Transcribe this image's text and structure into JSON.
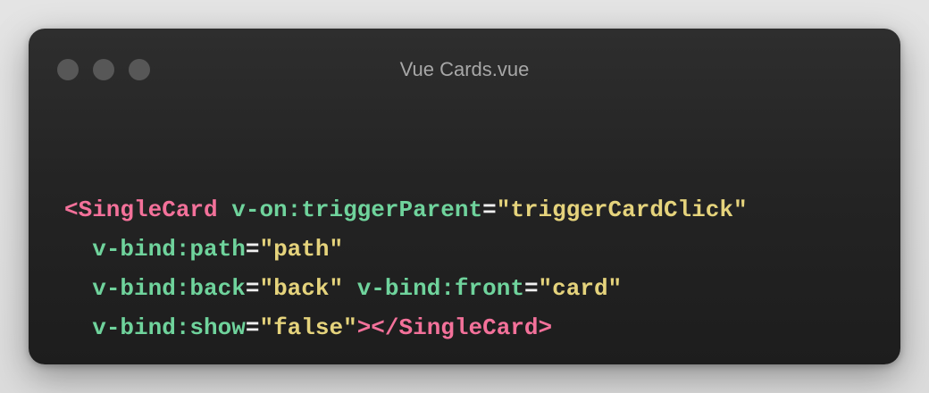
{
  "window": {
    "title": "Vue Cards.vue",
    "controls": [
      "close-dot",
      "minimize-dot",
      "maximize-dot"
    ]
  },
  "code": {
    "lines": [
      [
        {
          "t": "tag",
          "v": "<SingleCard"
        },
        {
          "t": "sp",
          "v": " "
        },
        {
          "t": "attr",
          "v": "v-on:triggerParent"
        },
        {
          "t": "eq",
          "v": "="
        },
        {
          "t": "str",
          "v": "\"triggerCardClick\""
        }
      ],
      [
        {
          "t": "sp",
          "v": "  "
        },
        {
          "t": "attr",
          "v": "v-bind:path"
        },
        {
          "t": "eq",
          "v": "="
        },
        {
          "t": "str",
          "v": "\"path\""
        }
      ],
      [
        {
          "t": "sp",
          "v": "  "
        },
        {
          "t": "attr",
          "v": "v-bind:back"
        },
        {
          "t": "eq",
          "v": "="
        },
        {
          "t": "str",
          "v": "\"back\""
        },
        {
          "t": "sp",
          "v": " "
        },
        {
          "t": "attr",
          "v": "v-bind:front"
        },
        {
          "t": "eq",
          "v": "="
        },
        {
          "t": "str",
          "v": "\"card\""
        }
      ],
      [
        {
          "t": "sp",
          "v": "  "
        },
        {
          "t": "attr",
          "v": "v-bind:show"
        },
        {
          "t": "eq",
          "v": "="
        },
        {
          "t": "str",
          "v": "\"false\""
        },
        {
          "t": "tag",
          "v": "></SingleCard>"
        }
      ]
    ]
  },
  "colors": {
    "tag": "#f3719a",
    "attr": "#6fd39c",
    "string": "#e5d37c",
    "punct": "#f0f0f0",
    "window_bg": "#262626",
    "dot": "#575757",
    "title": "#a7a7a7"
  }
}
